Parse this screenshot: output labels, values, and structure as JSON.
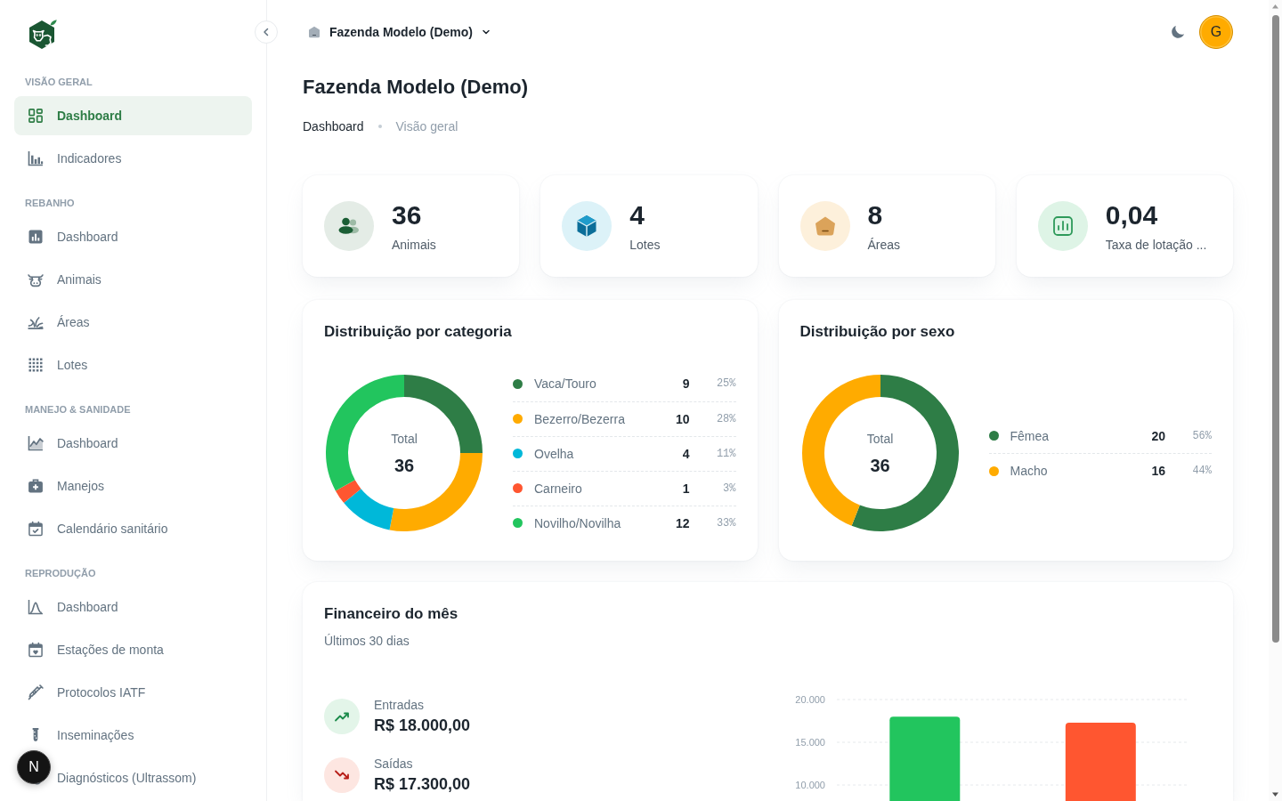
{
  "sidebar": {
    "sections": [
      {
        "title": "VISÃO GERAL",
        "items": [
          {
            "label": "Dashboard",
            "selected": true
          },
          {
            "label": "Indicadores",
            "selected": false
          }
        ]
      },
      {
        "title": "REBANHO",
        "items": [
          {
            "label": "Dashboard",
            "selected": false
          },
          {
            "label": "Animais",
            "selected": false
          },
          {
            "label": "Áreas",
            "selected": false
          },
          {
            "label": "Lotes",
            "selected": false
          }
        ]
      },
      {
        "title": "MANEJO & SANIDADE",
        "items": [
          {
            "label": "Dashboard",
            "selected": false
          },
          {
            "label": "Manejos",
            "selected": false
          },
          {
            "label": "Calendário sanitário",
            "selected": false
          }
        ]
      },
      {
        "title": "REPRODUÇÃO",
        "items": [
          {
            "label": "Dashboard",
            "selected": false
          },
          {
            "label": "Estações de monta",
            "selected": false
          },
          {
            "label": "Protocolos IATF",
            "selected": false
          },
          {
            "label": "Inseminações",
            "selected": false
          },
          {
            "label": "Diagnósticos (Ultrassom)",
            "selected": false
          }
        ]
      }
    ]
  },
  "topbar": {
    "farm_selector": {
      "label": "Fazenda Modelo (Demo)"
    },
    "avatar": {
      "initial": "G"
    }
  },
  "page_header": {
    "title": "Fazenda Modelo (Demo)",
    "breadcrumbs": [
      {
        "label": "Dashboard",
        "current": false
      },
      {
        "label": "Visão geral",
        "current": true
      }
    ]
  },
  "stats": [
    {
      "kind": "animals",
      "value": "36",
      "label": "Animais"
    },
    {
      "kind": "lots",
      "value": "4",
      "label": "Lotes"
    },
    {
      "kind": "areas",
      "value": "8",
      "label": "Áreas"
    },
    {
      "kind": "rate",
      "value": "0,04",
      "label": "Taxa de lotação ..."
    }
  ],
  "distribution_cards": [
    {
      "title": "Distribuição por categoria",
      "center_label": "Total",
      "center_value": "36",
      "chart_data": {
        "type": "donut",
        "values": [
          25,
          28,
          11,
          3,
          33
        ]
      },
      "legend": [
        {
          "label": "Vaca/Touro",
          "count": "9",
          "percent": "25%",
          "color": "#2e7d46"
        },
        {
          "label": "Bezerro/Bezerra",
          "count": "10",
          "percent": "28%",
          "color": "#ffab00"
        },
        {
          "label": "Ovelha",
          "count": "4",
          "percent": "11%",
          "color": "#00b8d9"
        },
        {
          "label": "Carneiro",
          "count": "1",
          "percent": "3%",
          "color": "#ff5630"
        },
        {
          "label": "Novilho/Novilha",
          "count": "12",
          "percent": "33%",
          "color": "#22c55e"
        }
      ]
    },
    {
      "title": "Distribuição por sexo",
      "center_label": "Total",
      "center_value": "36",
      "chart_data": {
        "type": "donut",
        "values": [
          56,
          44
        ]
      },
      "legend": [
        {
          "label": "Fêmea",
          "count": "20",
          "percent": "56%",
          "color": "#2e7d46"
        },
        {
          "label": "Macho",
          "count": "16",
          "percent": "44%",
          "color": "#ffab00"
        }
      ]
    }
  ],
  "finance_card": {
    "title": "Financeiro do mês",
    "subtitle": "Últimos 30 dias",
    "entries": [
      {
        "kind": "income",
        "label": "Entradas",
        "value": "R$ 18.000,00"
      },
      {
        "kind": "expense",
        "label": "Saídas",
        "value": "R$ 17.300,00"
      }
    ],
    "chart_data": {
      "type": "bar",
      "values": [
        18000,
        17300
      ],
      "colors": [
        "#22c55e",
        "#ff5630"
      ],
      "ylim": [
        0,
        20000
      ],
      "yticks": [
        {
          "value": 10000,
          "label": "10.000"
        },
        {
          "value": 15000,
          "label": "15.000"
        },
        {
          "value": 20000,
          "label": "20.000"
        }
      ]
    }
  },
  "dev_indicator": {
    "label": "N"
  }
}
